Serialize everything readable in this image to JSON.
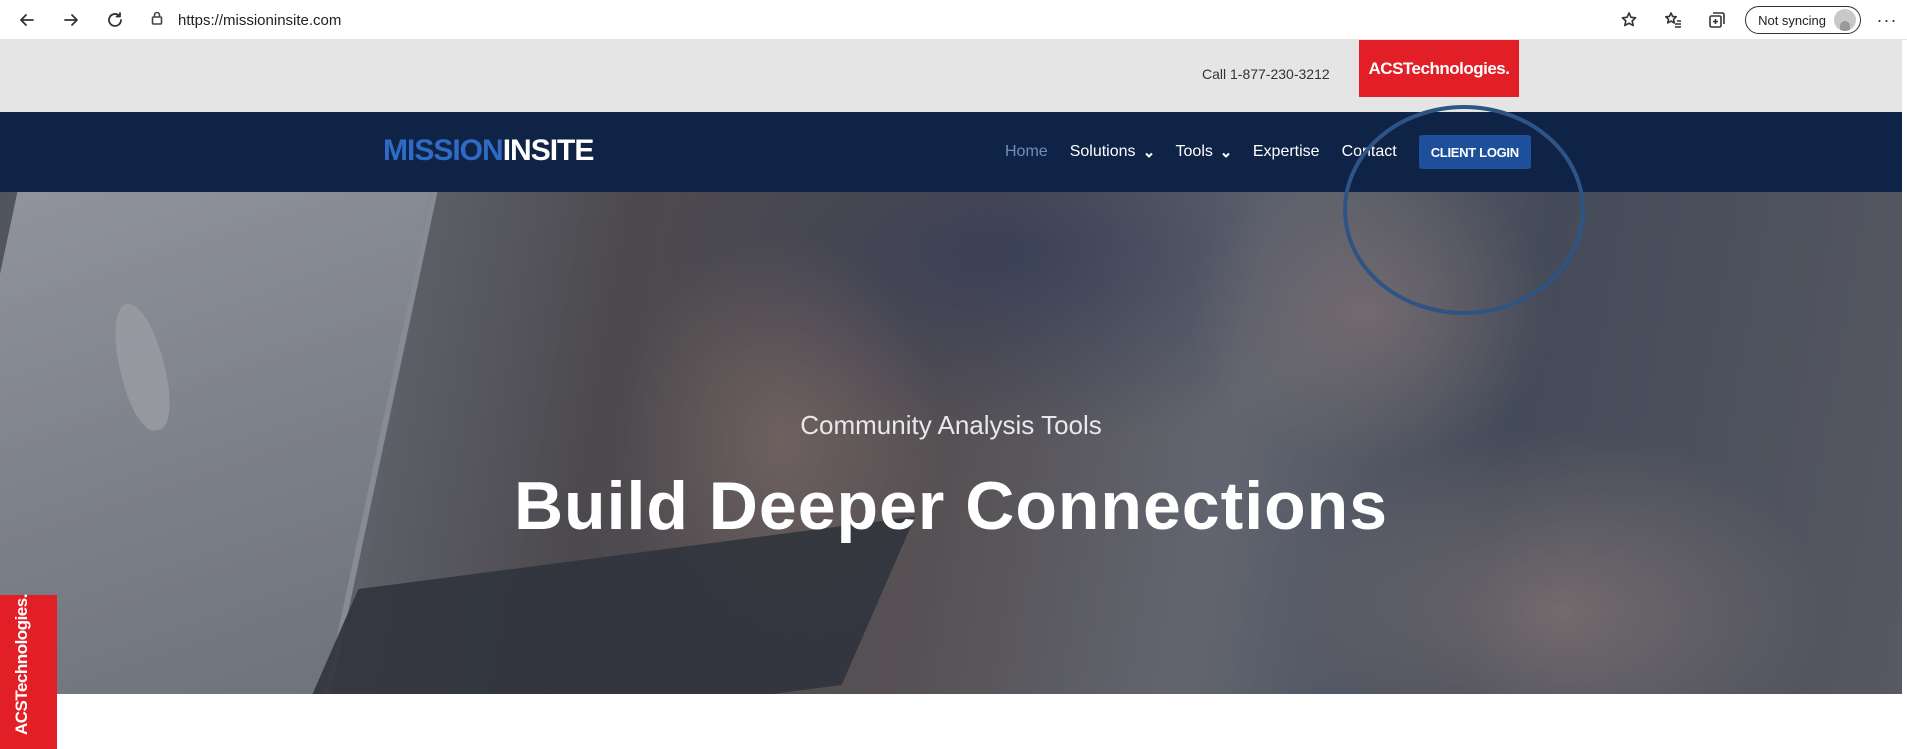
{
  "browser": {
    "url": "https://missioninsite.com",
    "sync_status": "Not syncing",
    "more_label": "···"
  },
  "topbar": {
    "call_text": "Call 1-877-230-3212",
    "acs_logo": "ACSTechnologies."
  },
  "navbar": {
    "brand_part1": "MISSION",
    "brand_part2": "INSITE",
    "links": [
      "Home",
      "Solutions",
      "Tools",
      "Expertise",
      "Contact"
    ],
    "login_label": "CLIENT LOGIN"
  },
  "hero": {
    "subtitle": "Community Analysis Tools",
    "title": "Build Deeper Connections"
  },
  "side_badge": {
    "label": "ACSTechnologies."
  },
  "colors": {
    "navbar_bg": "#0f2346",
    "topbar_bg": "#e5e5e5",
    "acs_red": "#e21f26",
    "login_btn": "#1e4f9a",
    "brand_blue": "#2f6bc4",
    "active_link": "#6f8fbf"
  }
}
